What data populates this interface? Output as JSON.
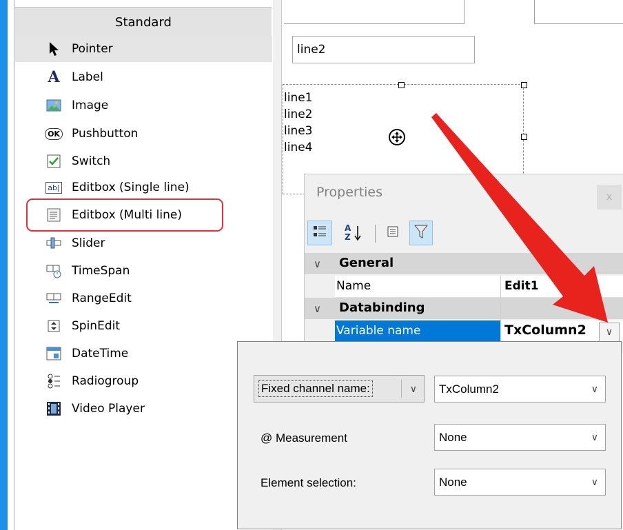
{
  "toolbox": {
    "header": "Standard",
    "items": [
      {
        "label": "Pointer",
        "icon": "pointer-icon"
      },
      {
        "label": "Label",
        "icon": "label-a-icon"
      },
      {
        "label": "Image",
        "icon": "image-icon"
      },
      {
        "label": "Pushbutton",
        "icon": "ok-button-icon"
      },
      {
        "label": "Switch",
        "icon": "checkbox-icon"
      },
      {
        "label": "Editbox (Single line)",
        "icon": "editbox-single-icon"
      },
      {
        "label": "Editbox (Multi line)",
        "icon": "editbox-multi-icon"
      },
      {
        "label": "Slider",
        "icon": "slider-icon"
      },
      {
        "label": "TimeSpan",
        "icon": "timespan-icon"
      },
      {
        "label": "RangeEdit",
        "icon": "rangeedit-icon"
      },
      {
        "label": "SpinEdit",
        "icon": "spinedit-icon"
      },
      {
        "label": "DateTime",
        "icon": "datetime-icon"
      },
      {
        "label": "Radiogroup",
        "icon": "radiogroup-icon"
      },
      {
        "label": "Video Player",
        "icon": "film-icon"
      }
    ],
    "pushbutton_icon_text": "OK",
    "editbox_icon_text": "ab|"
  },
  "canvas": {
    "single_line_value": "line2",
    "multi_line_values": [
      "line1",
      "line2",
      "line3",
      "line4"
    ]
  },
  "properties": {
    "title": "Properties",
    "close_label": "x",
    "sort_alpha_label": "A Z",
    "categories": [
      {
        "label": "General",
        "rows": [
          {
            "name": "Name",
            "value": "Edit1"
          }
        ]
      },
      {
        "label": "Databinding",
        "rows": [
          {
            "name": "Variable name",
            "value": "TxColumn2"
          }
        ]
      }
    ]
  },
  "popup": {
    "fixed_channel_label": "Fixed channel name:",
    "fixed_channel_value": "TxColumn2",
    "measurement_label": "@ Measurement",
    "measurement_value": "None",
    "element_selection_label": "Element selection:",
    "element_selection_value": "None"
  },
  "colors": {
    "accent": "#1e90e8",
    "selection": "#0078d7",
    "highlight": "#e0303a",
    "arrow": "#e8231e"
  }
}
